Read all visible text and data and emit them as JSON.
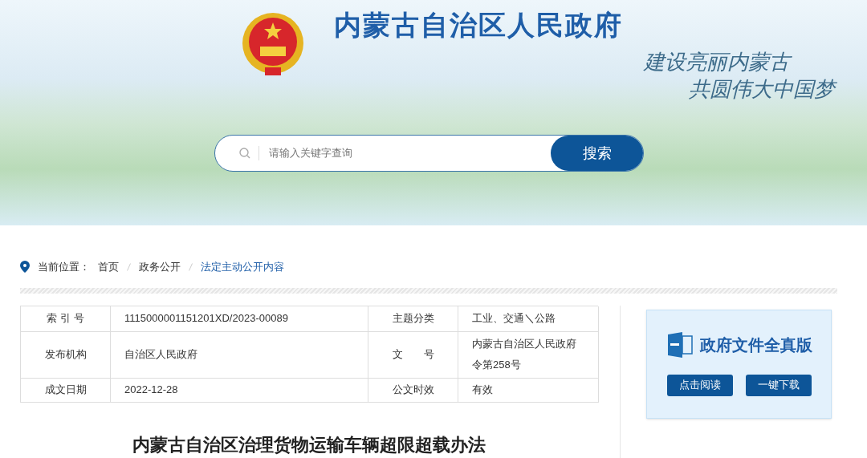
{
  "header": {
    "title": "内蒙古自治区人民政府",
    "slogan": [
      "建设亮丽内蒙古",
      "共圆伟大中国梦"
    ]
  },
  "search": {
    "placeholder": "请输入关键字查询",
    "button": "搜索"
  },
  "breadcrumb": {
    "label": "当前位置：",
    "items": [
      {
        "text": "首页",
        "selected": false
      },
      {
        "text": "政务公开",
        "selected": false
      },
      {
        "text": "法定主动公开内容",
        "selected": true
      }
    ]
  },
  "info_table": {
    "rows": [
      {
        "label": "索 引 号",
        "value": "1115000001151201XD/2023-00089",
        "label_2": "主题分类",
        "value_2": "工业、交通＼公路"
      },
      {
        "label": "发布机构",
        "value": "自治区人民政府",
        "label_2": "文　　号",
        "value_2": "内蒙古自治区人民政府令第258号"
      },
      {
        "label": "成文日期",
        "value": "2022-12-28",
        "label_2": "公文时效",
        "value_2": "有效"
      }
    ]
  },
  "document_card": {
    "title": "政府文件全真版",
    "buttons": [
      "点击阅读",
      "一键下载"
    ]
  },
  "article": {
    "title": "内蒙古自治区治理货物运输车辆超限超载办法"
  }
}
